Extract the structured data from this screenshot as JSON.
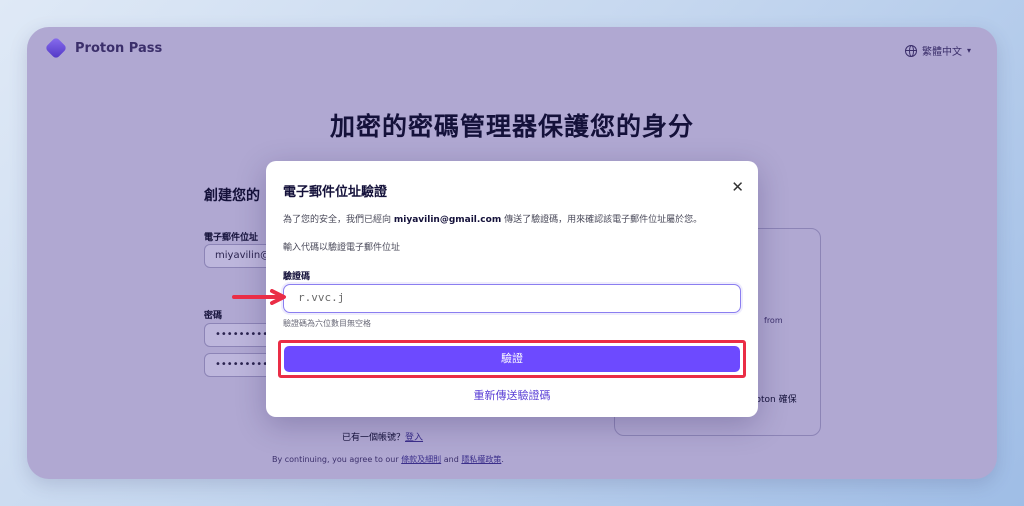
{
  "app": {
    "logo_text": "Proton Pass",
    "language_label": "繁體中文",
    "headline": "加密的密碼管理器保護您的身分"
  },
  "background_form": {
    "create_title": "創建您的",
    "email_label": "電子郵件位址",
    "email_value": "miyavilin@g",
    "password_label": "密碼",
    "password_value": "••••••••••",
    "confirm_value": "••••••••••",
    "panel_from_text": "from",
    "panel_proton_text": "roton 確保",
    "signin_prompt": "已有一個帳號？",
    "signin_link": "登入",
    "terms_prefix": "By continuing, you agree to our",
    "terms_link": "條款及細則",
    "terms_and": "and",
    "privacy_link": "隱私權政策",
    "terms_suffix": "."
  },
  "modal": {
    "title": "電子郵件位址驗證",
    "close_label": "✕",
    "message_before": "為了您的安全，我們已經向",
    "message_email": "miyavilin@gmail.com",
    "message_after": "傳送了驗證碼，用來確認該電子郵件位址屬於您。",
    "instruction": "輸入代碼以驗證電子郵件位址",
    "code_label": "驗證碼",
    "code_value": "r.vvc.j",
    "hint": "驗證碼為六位數目無空格",
    "verify_button": "驗證",
    "resend_link": "重新傳送驗證碼"
  },
  "colors": {
    "overlay": "#b0a8d2",
    "primary": "#6d4aff",
    "annotation_red": "#ea2d46"
  },
  "icons": {
    "logo": "proton-pass-logo-icon",
    "language": "globe-icon",
    "close": "close-icon",
    "annotation": "red-arrow-icon"
  }
}
